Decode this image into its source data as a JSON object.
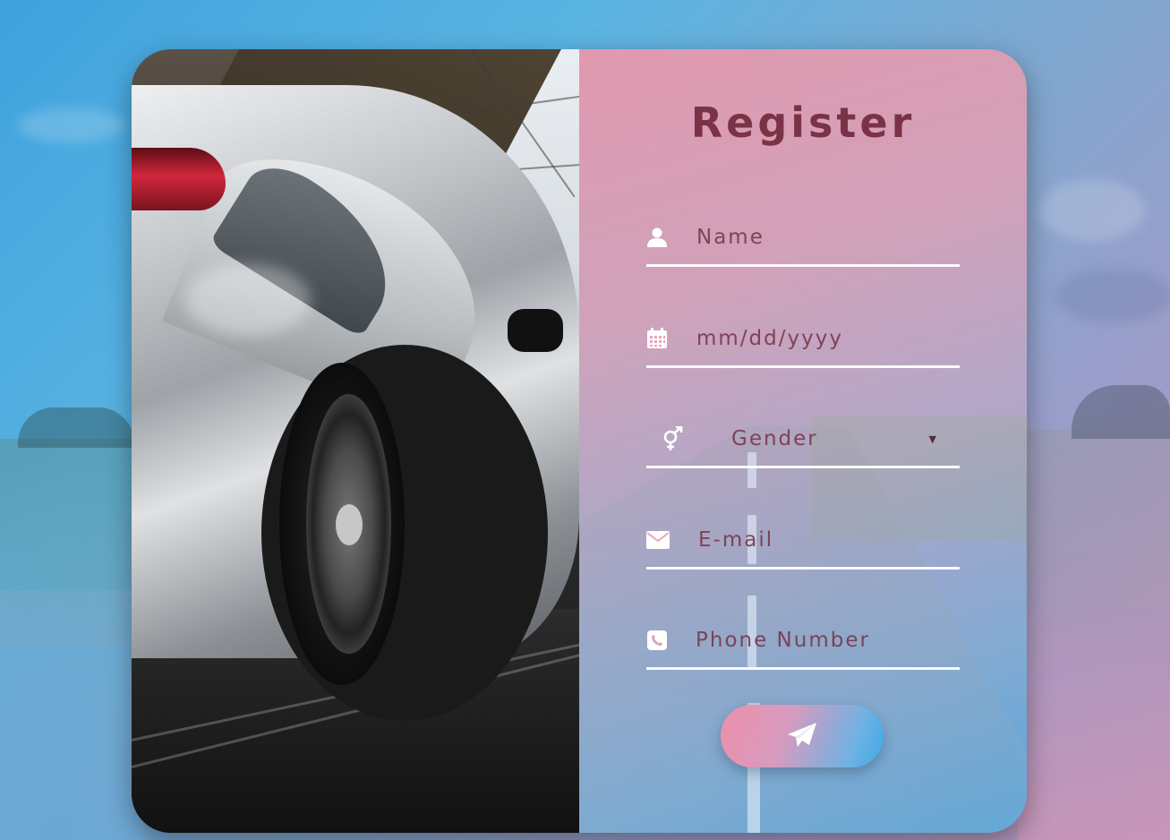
{
  "form": {
    "title": "Register",
    "name_placeholder": "Name",
    "date_placeholder": "mm/dd/yyyy",
    "gender_selected": "Gender",
    "email_placeholder": "E-mail",
    "phone_placeholder": "Phone Number"
  },
  "icons": {
    "name": "user-icon",
    "date": "calendar-icon",
    "gender": "gender-icon",
    "email": "envelope-icon",
    "phone": "phone-icon",
    "submit": "paper-plane-icon"
  },
  "colors": {
    "title": "#7a3346",
    "underline": "#ffffff",
    "button_start": "#ee8fa8",
    "button_end": "#3ea9e6",
    "icon": "#ffffff"
  }
}
